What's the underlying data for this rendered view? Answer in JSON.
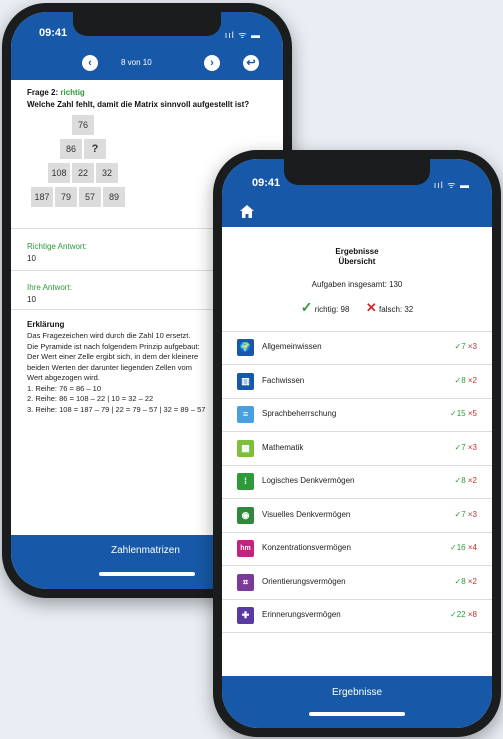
{
  "back_phone": {
    "time": "09:41",
    "signal": "ııl ᯤ ▬",
    "nav": {
      "prev_icon": "chevron-left-icon",
      "counter": "8 von 10",
      "next_icon": "chevron-right-icon",
      "exit_icon": "exit-icon"
    },
    "question": {
      "label": "Frage 2:",
      "result": "richtig",
      "text": "Welche Zahl fehlt, damit die Matrix sinnvoll aufgestellt ist?"
    },
    "pyramid": [
      [
        "76"
      ],
      [
        "86",
        "?"
      ],
      [
        "108",
        "22",
        "32"
      ],
      [
        "187",
        "79",
        "57",
        "89"
      ]
    ],
    "correct_label": "Richtige Antwort:",
    "correct_value": "10",
    "your_label": "Ihre Antwort:",
    "your_value": "10",
    "explanation_title": "Erklärung",
    "explanation_lines": [
      "Das Fragezeichen wird durch die Zahl 10 ersetzt.",
      "Die Pyramide ist nach folgendem Prinzip aufgebaut:",
      "Der Wert einer Zelle ergibt sich, in dem der kleinere",
      "beiden Werten der darunter liegenden Zellen vom",
      "Wert abgezogen wird.",
      "1. Reihe: 76 = 86 – 10",
      "2. Reihe: 86 = 108 – 22 | 10 = 32 – 22",
      "3. Reihe: 108 = 187 – 79 | 22 = 79 – 57 | 32 = 89 – 57"
    ],
    "footer": "Zahlenmatrizen"
  },
  "front_phone": {
    "time": "09:41",
    "signal": "ııl ᯤ ▬",
    "home_icon": "home-icon",
    "title": "Ergebnisse",
    "subtitle": "Übersicht",
    "total": "Aufgaben insgesamt: 130",
    "correct_summary": "richtig: 98",
    "wrong_summary": "falsch: 32",
    "categories": [
      {
        "name": "Allgemeinwissen",
        "correct": "✓7",
        "wrong": "×3",
        "icon": "globe-icon",
        "color": "#1759a8",
        "glyph": "🌍"
      },
      {
        "name": "Fachwissen",
        "correct": "✓8",
        "wrong": "×2",
        "icon": "books-icon",
        "color": "#1759a8",
        "glyph": "▥"
      },
      {
        "name": "Sprachbeherrschung",
        "correct": "✓15",
        "wrong": "×5",
        "icon": "document-icon",
        "color": "#4a9fe0",
        "glyph": "≡"
      },
      {
        "name": "Mathematik",
        "correct": "✓7",
        "wrong": "×3",
        "icon": "calculator-icon",
        "color": "#7cbf3a",
        "glyph": "▦"
      },
      {
        "name": "Logisches Denkvermögen",
        "correct": "✓8",
        "wrong": "×2",
        "icon": "logic-icon",
        "color": "#2e9a3a",
        "glyph": "⁞"
      },
      {
        "name": "Visuelles Denkvermögen",
        "correct": "✓7",
        "wrong": "×3",
        "icon": "eye-icon",
        "color": "#2e8a3a",
        "glyph": "◉"
      },
      {
        "name": "Konzentrationsvermögen",
        "correct": "✓16",
        "wrong": "×4",
        "icon": "concentration-icon",
        "color": "#c0257d",
        "glyph": "hm"
      },
      {
        "name": "Orientierungsvermögen",
        "correct": "✓8",
        "wrong": "×2",
        "icon": "map-icon",
        "color": "#7a3a9a",
        "glyph": "⌗"
      },
      {
        "name": "Erinnerungsvermögen",
        "correct": "✓22",
        "wrong": "×8",
        "icon": "puzzle-icon",
        "color": "#5a3aa0",
        "glyph": "✚"
      }
    ],
    "footer": "Ergebnisse"
  }
}
